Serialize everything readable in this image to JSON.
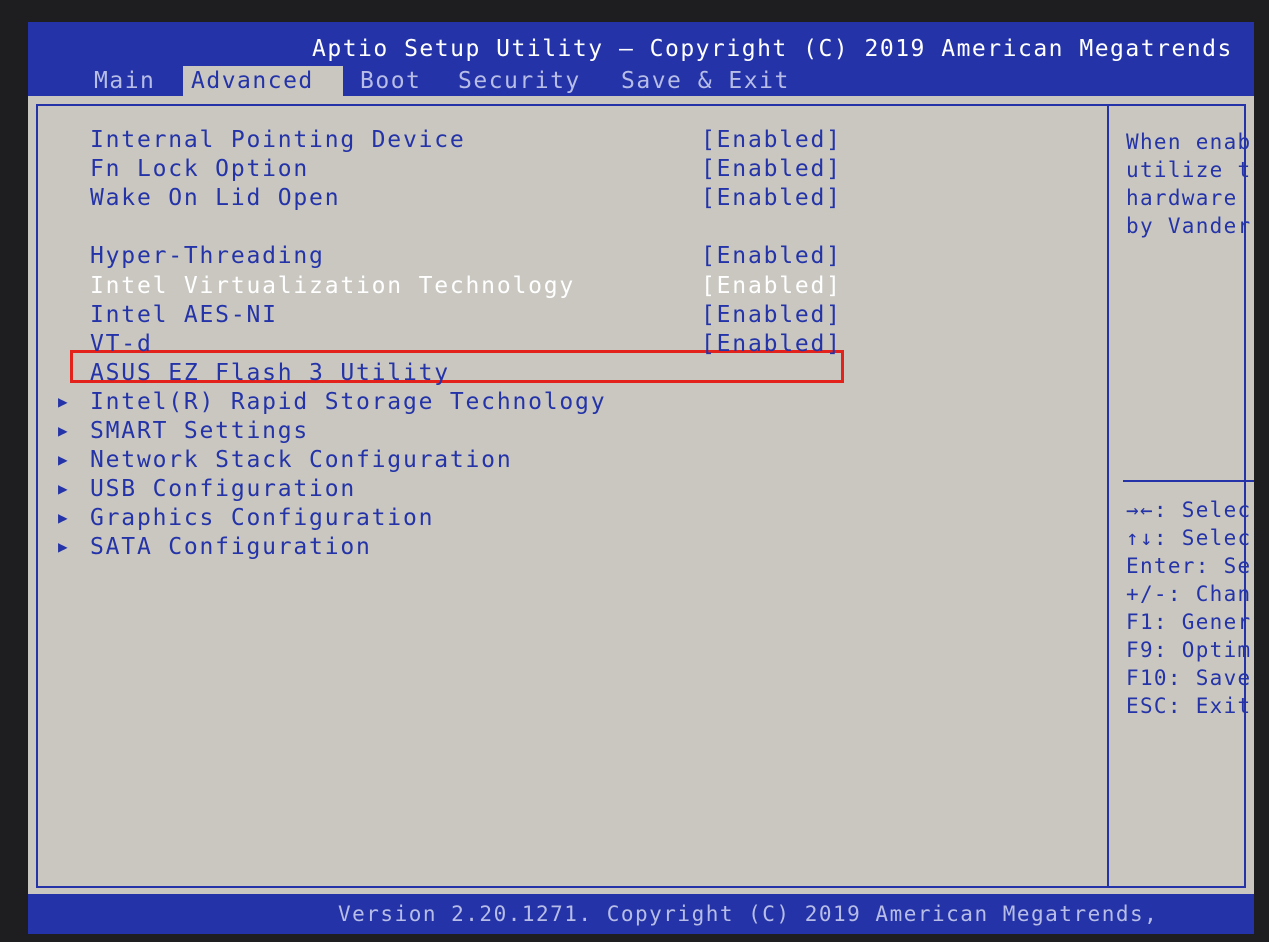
{
  "header": {
    "title": "Aptio Setup Utility – Copyright (C) 2019 American Megatrends",
    "tabs": [
      "Main",
      "Advanced",
      "Boot",
      "Security",
      "Save & Exit"
    ],
    "active_tab": "Advanced"
  },
  "settings": [
    {
      "label": "Internal Pointing Device",
      "value": "[Enabled]"
    },
    {
      "label": "Fn Lock Option",
      "value": "[Enabled]"
    },
    {
      "label": "Wake On Lid Open",
      "value": "[Enabled]"
    },
    {
      "label": "Hyper-Threading",
      "value": "[Enabled]"
    },
    {
      "label": "Intel Virtualization Technology",
      "value": "[Enabled]",
      "selected": true
    },
    {
      "label": "Intel AES-NI",
      "value": "[Enabled]"
    },
    {
      "label": "VT-d",
      "value": "[Enabled]"
    },
    {
      "label": "ASUS EZ Flash 3 Utility"
    }
  ],
  "submenus": [
    {
      "label": "Intel(R) Rapid Storage Technology"
    },
    {
      "label": "SMART Settings"
    },
    {
      "label": "Network Stack Configuration"
    },
    {
      "label": "USB Configuration"
    },
    {
      "label": "Graphics Configuration"
    },
    {
      "label": "SATA Configuration"
    }
  ],
  "submenu_arrow_icon": "triangle-right-icon",
  "help_text": [
    "When enab",
    "utilize t",
    "hardware ",
    "by Vander"
  ],
  "key_help": [
    "→←: Selec",
    "↑↓: Selec",
    "Enter: Se",
    "+/-: Chan",
    "F1: Gener",
    "F9: Optim",
    "F10: Save",
    "ESC: Exit"
  ],
  "footer": {
    "version": "Version 2.20.1271. Copyright (C) 2019 American Megatrends,"
  },
  "colors": {
    "bios_blue": "#2434a8",
    "screen_gray": "#c9c7c0",
    "highlight_red": "#e3221c"
  }
}
